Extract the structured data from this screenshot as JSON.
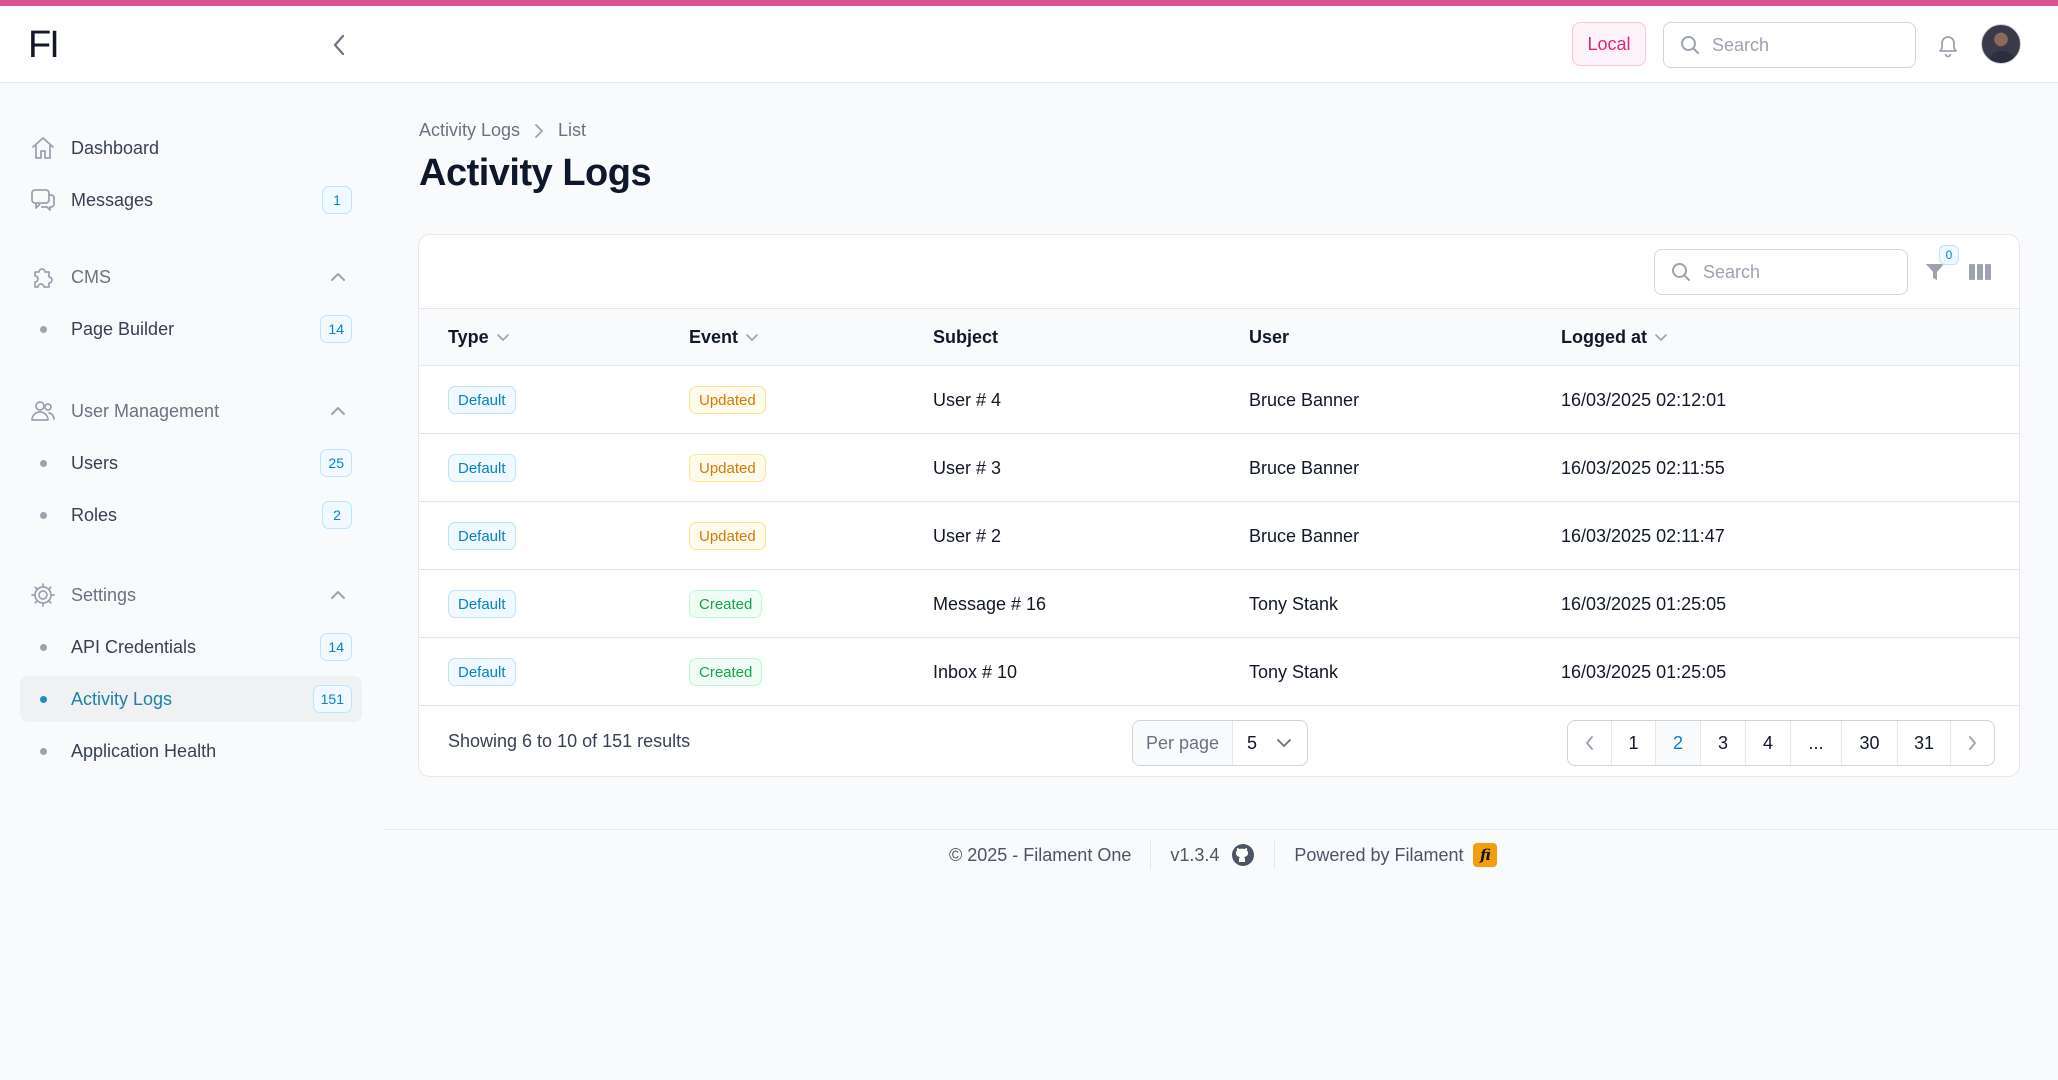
{
  "app": {
    "logo_text": "FI",
    "environment_label": "Local"
  },
  "header": {
    "search_placeholder": "Search"
  },
  "sidebar": {
    "dashboard_label": "Dashboard",
    "messages_label": "Messages",
    "messages_count": "1",
    "groups": [
      {
        "label": "CMS",
        "items": [
          {
            "label": "Page Builder",
            "count": "14"
          }
        ]
      },
      {
        "label": "User Management",
        "items": [
          {
            "label": "Users",
            "count": "25"
          },
          {
            "label": "Roles",
            "count": "2"
          }
        ]
      },
      {
        "label": "Settings",
        "items": [
          {
            "label": "API Credentials",
            "count": "14"
          },
          {
            "label": "Activity Logs",
            "count": "151"
          },
          {
            "label": "Application Health",
            "count": ""
          }
        ]
      }
    ]
  },
  "breadcrumb": {
    "parent": "Activity Logs",
    "current": "List"
  },
  "page": {
    "title": "Activity Logs"
  },
  "table": {
    "search_placeholder": "Search",
    "filter_count": "0",
    "columns": [
      "Type",
      "Event",
      "Subject",
      "User",
      "Logged at"
    ],
    "rows": [
      {
        "type": "Default",
        "event": "Updated",
        "subject": "User # 4",
        "user": "Bruce Banner",
        "logged_at": "16/03/2025 02:12:01"
      },
      {
        "type": "Default",
        "event": "Updated",
        "subject": "User # 3",
        "user": "Bruce Banner",
        "logged_at": "16/03/2025 02:11:55"
      },
      {
        "type": "Default",
        "event": "Updated",
        "subject": "User # 2",
        "user": "Bruce Banner",
        "logged_at": "16/03/2025 02:11:47"
      },
      {
        "type": "Default",
        "event": "Created",
        "subject": "Message # 16",
        "user": "Tony Stank",
        "logged_at": "16/03/2025 01:25:05"
      },
      {
        "type": "Default",
        "event": "Created",
        "subject": "Inbox # 10",
        "user": "Tony Stank",
        "logged_at": "16/03/2025 01:25:05"
      }
    ],
    "results_text": "Showing 6 to 10 of 151 results",
    "per_page_label": "Per page",
    "per_page_value": "5",
    "pages": [
      "1",
      "2",
      "3",
      "4",
      "...",
      "30",
      "31"
    ],
    "current_page": "2"
  },
  "footer": {
    "copyright": "© 2025 - Filament One",
    "version": "v1.3.4",
    "powered_by": "Powered by Filament",
    "brand_mark": "fi"
  },
  "colors": {
    "accent_stripe": "#db5690",
    "primary": "#0284c7",
    "warning": "#d97706",
    "success": "#16a34a"
  }
}
